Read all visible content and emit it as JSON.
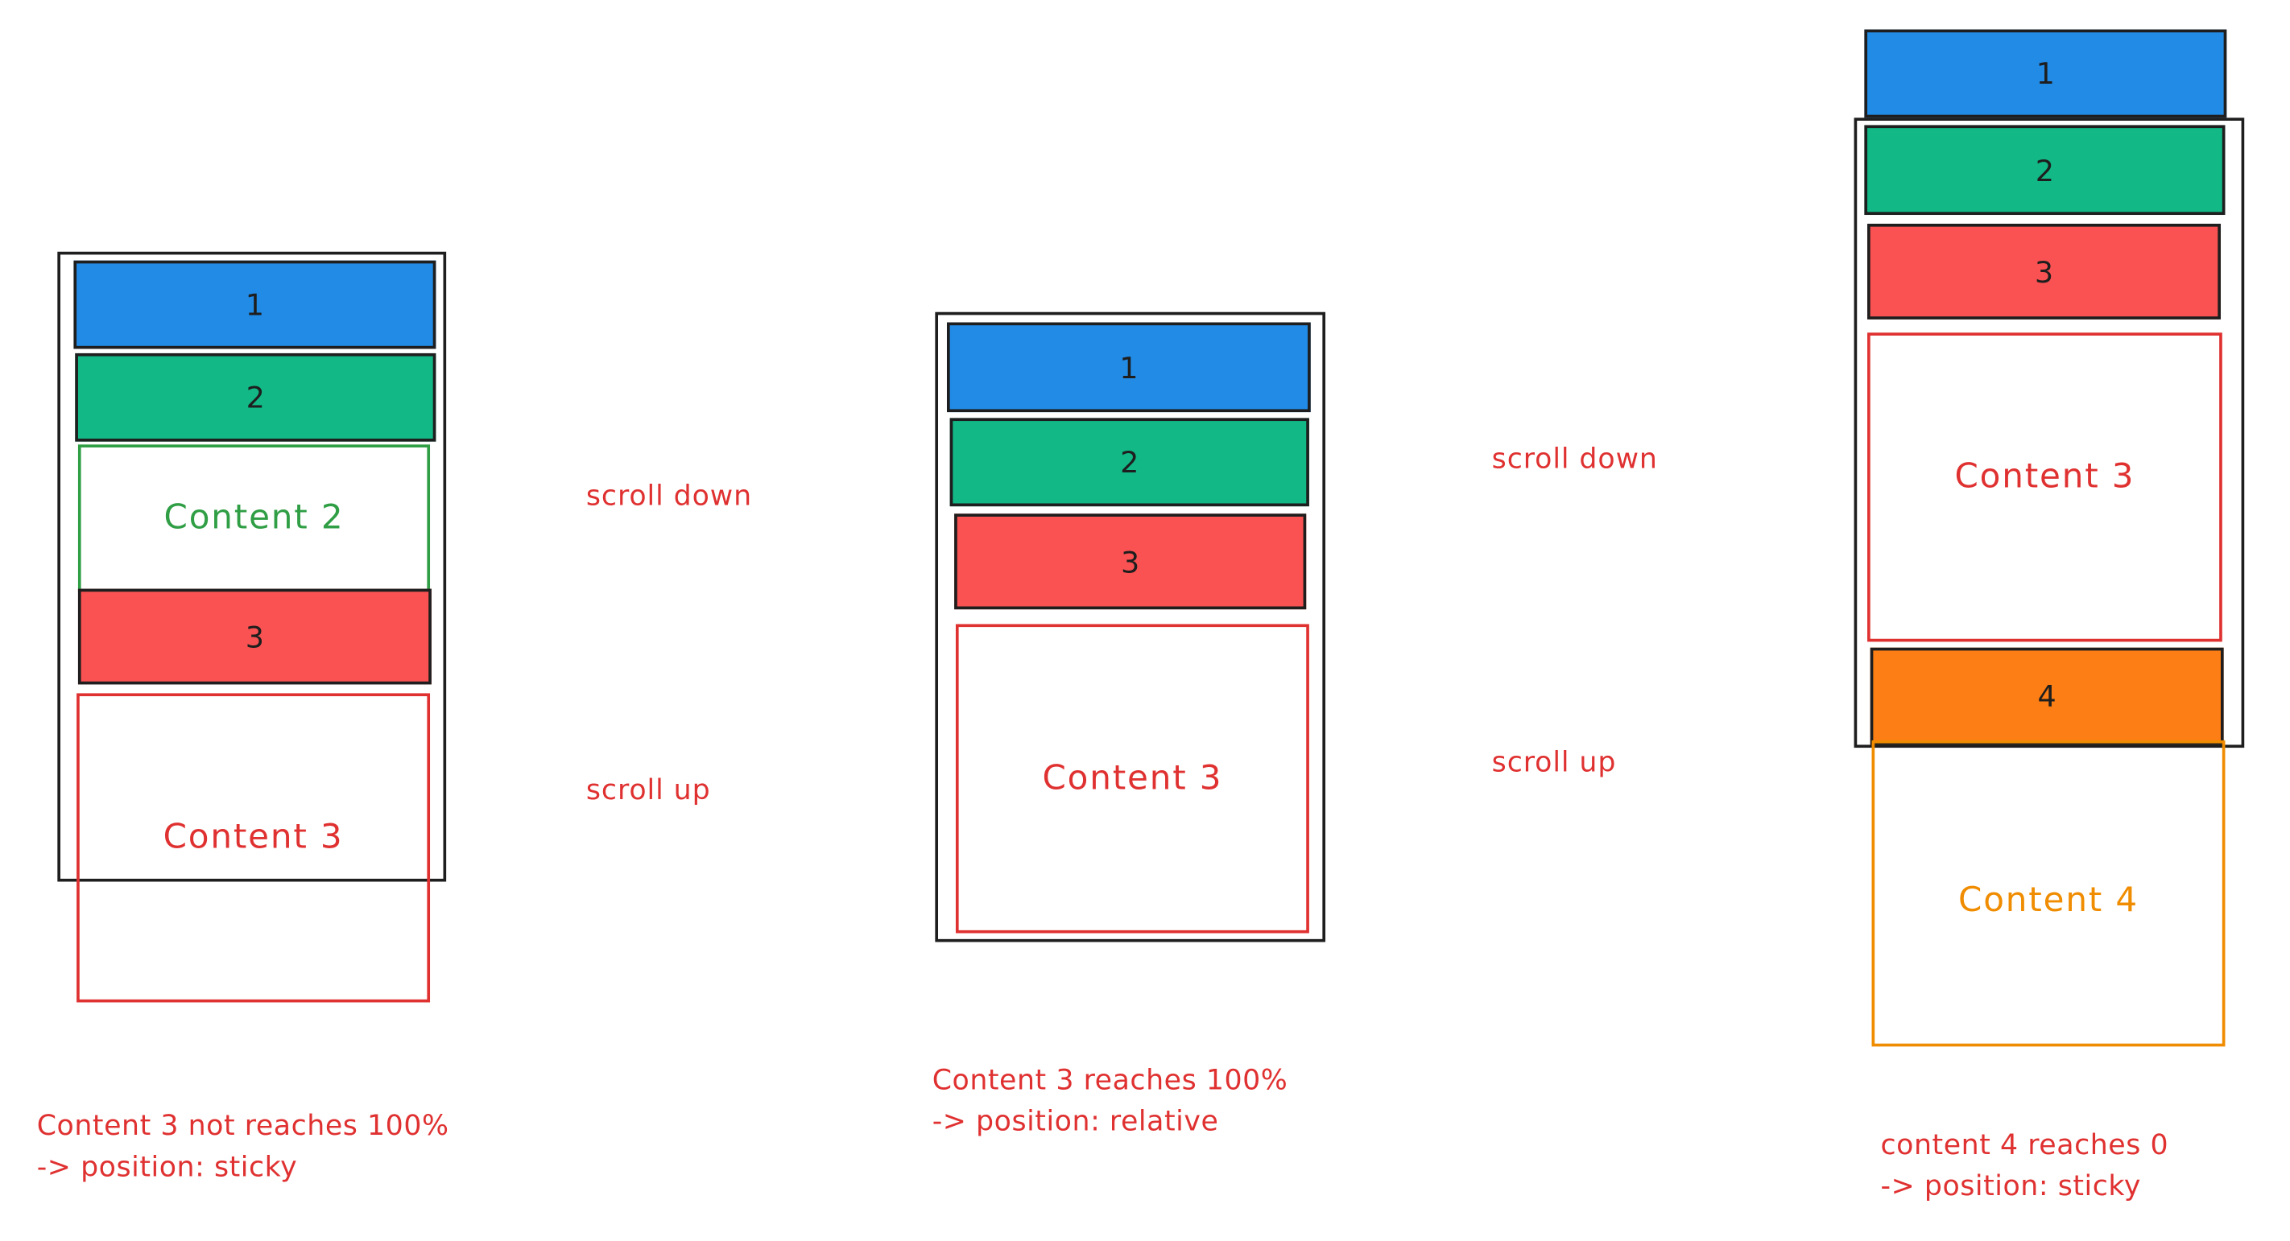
{
  "colors": {
    "blue": "#228be6",
    "green": "#12b886",
    "red": "#fa5252",
    "orange": "#fd7e14",
    "content_green": "#2f9e44",
    "content_red": "#e03131",
    "content_orange": "#f08c00",
    "annotation": "#e03131",
    "outline": "#1e1e1e"
  },
  "panel1": {
    "bar1": "1",
    "bar2": "2",
    "content2": "Content 2",
    "bar3": "3",
    "content3": "Content 3",
    "caption_line1": "Content 3 not reaches 100%",
    "caption_line2": "-> position: sticky"
  },
  "panel2": {
    "bar1": "1",
    "bar2": "2",
    "bar3": "3",
    "content3": "Content 3",
    "caption_line1": "Content 3 reaches 100%",
    "caption_line2": "-> position: relative"
  },
  "panel3": {
    "bar1": "1",
    "bar2": "2",
    "bar3": "3",
    "content3": "Content 3",
    "bar4": "4",
    "content4": "Content 4",
    "caption_line1": "content 4 reaches 0",
    "caption_line2": "-> position: sticky"
  },
  "transitions": {
    "scroll_down_1": "scroll down",
    "scroll_up_1": "scroll up",
    "scroll_down_2": "scroll down",
    "scroll_up_2": "scroll up"
  }
}
